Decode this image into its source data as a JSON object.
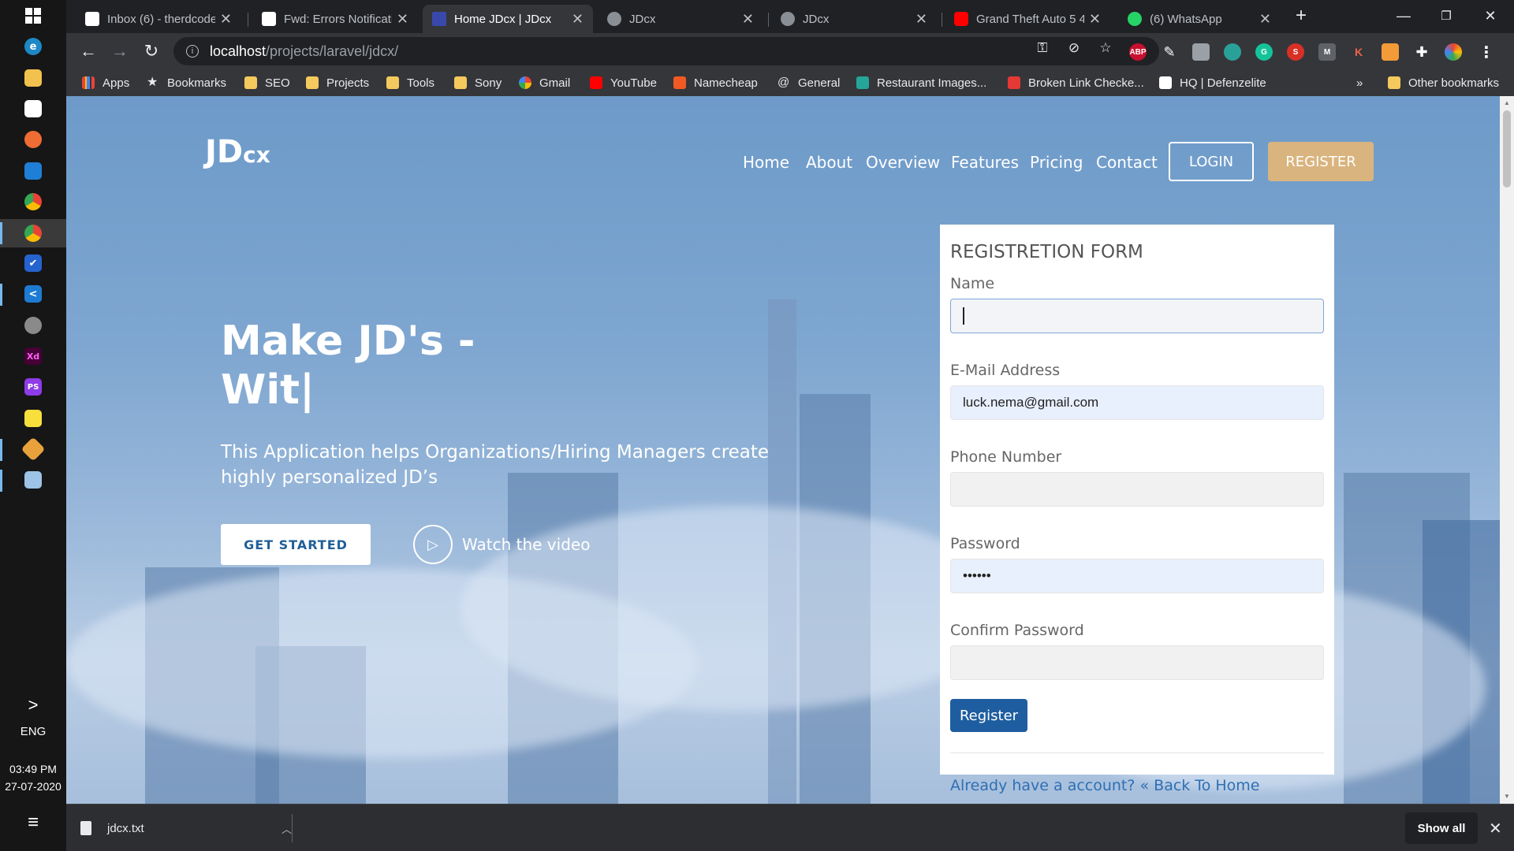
{
  "taskbar": {
    "language": "ENG",
    "time": "03:49 PM",
    "date": "27-07-2020",
    "show_hidden": ">",
    "notification": "≡"
  },
  "tabs": [
    {
      "title": "Inbox (6) - therdcode",
      "icon": "gmail-icon"
    },
    {
      "title": "Fwd: Errors Notificatio",
      "icon": "gmail-icon"
    },
    {
      "title": "Home JDcx | JDcx",
      "icon": "jdcx-icon"
    },
    {
      "title": "JDcx",
      "icon": "globe-icon"
    },
    {
      "title": "JDcx",
      "icon": "globe-icon"
    },
    {
      "title": "Grand Theft Auto 5 4",
      "icon": "youtube-icon"
    },
    {
      "title": "(6) WhatsApp",
      "icon": "whatsapp-icon"
    }
  ],
  "address_bar": {
    "host": "localhost",
    "path": "/projects/laravel/jdcx/"
  },
  "extensions": {
    "abp": "ABP",
    "medium": "M",
    "k": "K"
  },
  "bookmarks": {
    "apps": "Apps",
    "items": [
      "Bookmarks",
      "SEO",
      "Projects",
      "Tools",
      "Sony",
      "Gmail",
      "YouTube",
      "Namecheap",
      "General",
      "Restaurant Images...",
      "Broken Link Checke...",
      "HQ | Defenzelite"
    ],
    "more": "»",
    "other": "Other bookmarks"
  },
  "site": {
    "logo_main": "JD",
    "logo_small": "cx",
    "nav": [
      "Home",
      "About",
      "Overview",
      "Features",
      "Pricing",
      "Contact"
    ],
    "login": "LOGIN",
    "register": "REGISTER"
  },
  "hero": {
    "title_line1": "Make JD's -",
    "title_line2": "Wit|",
    "subtitle": "This Application helps Organizations/Hiring Managers create highly personalized JD’s",
    "cta": "GET STARTED",
    "video": "Watch the video"
  },
  "form": {
    "title": "REGISTRETION FORM",
    "name_label": "Name",
    "name_value": "",
    "email_label": "E-Mail Address",
    "email_value": "luck.nema@gmail.com",
    "phone_label": "Phone Number",
    "phone_value": "",
    "password_label": "Password",
    "password_value": "••••••",
    "confirm_label": "Confirm Password",
    "confirm_value": "",
    "submit": "Register",
    "footer_link": "Already have a account? « Back To Home"
  },
  "downloads": {
    "file": "jdcx.txt",
    "show_all": "Show all"
  },
  "colors": {
    "accent_register": "#d9b47e",
    "form_button": "#1e5ea0",
    "link": "#2f6fb3"
  }
}
